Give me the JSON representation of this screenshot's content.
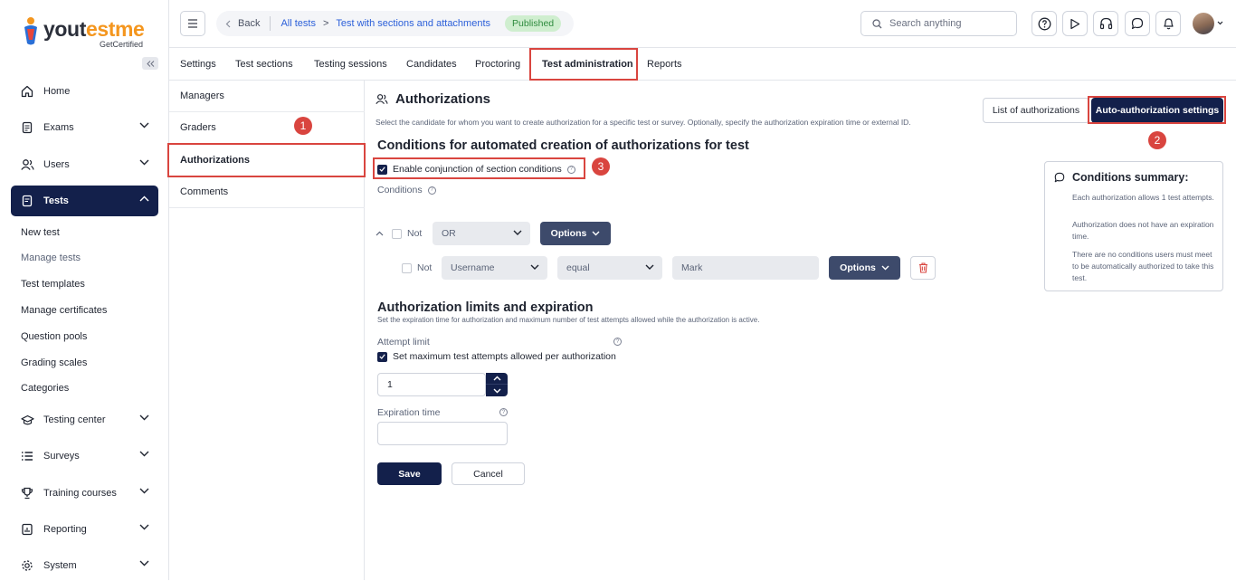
{
  "brand": {
    "name_part1": "you",
    "name_o": "t",
    "name_part2": "estme",
    "tagline": "GetCertified"
  },
  "sidebar": {
    "items": [
      {
        "label": "Home",
        "icon": "home-icon"
      },
      {
        "label": "Exams",
        "icon": "document-icon"
      },
      {
        "label": "Users",
        "icon": "users-icon"
      },
      {
        "label": "Tests",
        "icon": "test-icon"
      },
      {
        "label": "Testing center",
        "icon": "graduation-cap-icon"
      },
      {
        "label": "Surveys",
        "icon": "list-icon"
      },
      {
        "label": "Training courses",
        "icon": "trophy-icon"
      },
      {
        "label": "Reporting",
        "icon": "report-icon"
      },
      {
        "label": "System",
        "icon": "gear-icon"
      }
    ],
    "tests_subitems": [
      "New test",
      "Manage tests",
      "Test templates",
      "Manage certificates",
      "Question pools",
      "Grading scales",
      "Categories"
    ]
  },
  "topbar": {
    "back_label": "Back",
    "crumb1": "All tests",
    "crumb_sep": ">",
    "crumb2": "Test with sections and attachments",
    "status": "Published",
    "search_placeholder": "Search anything"
  },
  "tabs": [
    "Settings",
    "Test sections",
    "Testing sessions",
    "Candidates",
    "Proctoring",
    "Test administration",
    "Reports"
  ],
  "submenu": [
    "Managers",
    "Graders",
    "Authorizations",
    "Comments"
  ],
  "annotations": [
    "1",
    "2",
    "3"
  ],
  "main": {
    "title": "Authorizations",
    "description": "Select the candidate for whom you want to create authorization for a specific test or survey. Optionally, specify the authorization expiration time or external ID.",
    "list_button": "List of authorizations",
    "auto_button": "Auto-authorization settings",
    "conditions_heading": "Conditions for automated creation of authorizations for test",
    "enable_conjunction_label": "Enable conjunction of section conditions",
    "conditions_label": "Conditions",
    "not_label": "Not",
    "or_value": "OR",
    "options_label": "Options",
    "field_value": "Username",
    "operator_value": "equal",
    "value_placeholder": "Mark",
    "limits_heading": "Authorization limits and expiration",
    "limits_desc": "Set the expiration time for authorization and maximum number of test attempts allowed while the authorization is active.",
    "attempt_limit_label": "Attempt limit",
    "set_max_label": "Set maximum test attempts allowed per authorization",
    "attempts_value": "1",
    "expiration_label": "Expiration time",
    "save_label": "Save",
    "cancel_label": "Cancel"
  },
  "summary": {
    "title": "Conditions summary:",
    "lines": [
      "Each authorization allows 1 test attempts.",
      "Authorization does not have an expiration time.",
      "There are no conditions users must meet to be automatically authorized to take this test."
    ]
  },
  "colors": {
    "primary": "#13204b",
    "annotation": "#d9453f",
    "published_bg": "#cfeecf",
    "link": "#2b5fd9"
  }
}
